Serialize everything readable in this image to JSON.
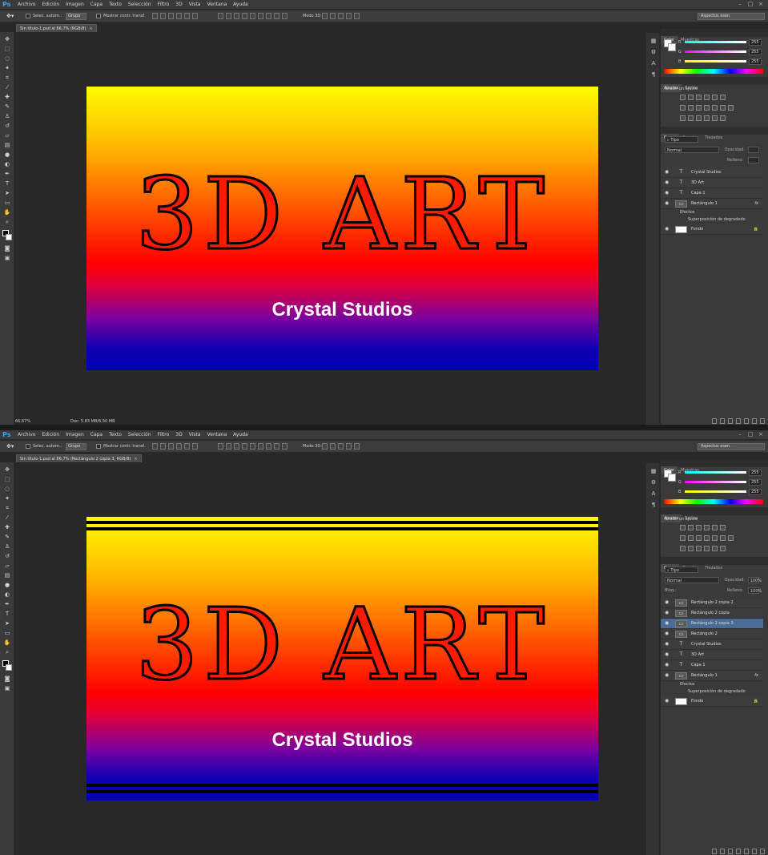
{
  "colors": {
    "workspace_bg": "#282828",
    "panel_bg": "#3a3a3a",
    "layer_selected": "#4a6c94",
    "headline_fill": "#ff1a00",
    "subtitle_text": "#ffffff"
  },
  "app": {
    "logo": "Ps",
    "menu": [
      "Archivo",
      "Edición",
      "Imagen",
      "Capa",
      "Texto",
      "Selección",
      "Filtro",
      "3D",
      "Vista",
      "Ventana",
      "Ayuda"
    ],
    "window_controls": [
      "–",
      "□",
      "×"
    ]
  },
  "options_bar": {
    "auto_select_label": "Selec. autom.:",
    "auto_select_value": "Grupo",
    "transform_label": "Mostrar contr. transf.",
    "mode_3d_label": "Modo 3D:",
    "workspace": "Aspectos esen."
  },
  "screens": [
    {
      "doc_tab": "Sin título-1.psd al 66,7% (RGB/8)",
      "zoom": "66,67%",
      "doc_size": "Doc: 5,83 MB/6,50 MB",
      "artwork": {
        "headline": "3D ART",
        "subtitle": "Crystal Studios",
        "stripes": false
      },
      "color_panel": {
        "tabs": [
          "Color",
          "Muestras"
        ],
        "r": "255",
        "g": "255",
        "b": "255",
        "r_label": "R",
        "g_label": "G",
        "b_label": "B"
      },
      "adjust_panel": {
        "tabs": [
          "Ajustes",
          "Estilos"
        ],
        "title": "Añadir un ajuste"
      },
      "layers_panel": {
        "tabs": [
          "Capas",
          "Canales",
          "Trazados"
        ],
        "filter": "Tipo",
        "blend": "Normal",
        "opacity_label": "Opacidad:",
        "opacity": "",
        "fill_label": "Relleno:",
        "fill": "",
        "lock_label": "",
        "layers": [
          {
            "name": "Crystal Studios",
            "kind": "text",
            "selected": false
          },
          {
            "name": "3D Art",
            "kind": "text",
            "selected": false
          },
          {
            "name": "Capa 1",
            "kind": "text",
            "selected": false
          },
          {
            "name": "Rectángulo 1",
            "kind": "shape",
            "selected": false,
            "fx": "fx",
            "effects": "Efectos",
            "effect": "Superposición de degradado"
          },
          {
            "name": "Fondo",
            "kind": "bg",
            "selected": false,
            "lock": "🔒"
          }
        ]
      }
    },
    {
      "doc_tab": "Sin título-1.psd al 66,7% (Rectángulo 2 copia 3, RGB/8)",
      "zoom": "",
      "doc_size": "",
      "artwork": {
        "headline": "3D ART",
        "subtitle": "Crystal Studios",
        "stripes": true
      },
      "color_panel": {
        "tabs": [
          "Color",
          "Muestras"
        ],
        "r": "255",
        "g": "255",
        "b": "255",
        "r_label": "R",
        "g_label": "G",
        "b_label": "B"
      },
      "adjust_panel": {
        "tabs": [
          "Ajustes",
          "Estilos"
        ],
        "title": "Añadir un ajuste"
      },
      "layers_panel": {
        "tabs": [
          "Capas",
          "Canales",
          "Trazados"
        ],
        "filter": "Tipo",
        "blend": "Normal",
        "opacity_label": "Opacidad:",
        "opacity": "100%",
        "fill_label": "Relleno:",
        "fill": "100%",
        "lock_label": "Bloq.:",
        "layers": [
          {
            "name": "Rectángulo 2 copia 2",
            "kind": "shape",
            "selected": false
          },
          {
            "name": "Rectángulo 2 copia",
            "kind": "shape",
            "selected": false
          },
          {
            "name": "Rectángulo 2 copia 3",
            "kind": "shape",
            "selected": true
          },
          {
            "name": "Rectángulo 2",
            "kind": "shape",
            "selected": false
          },
          {
            "name": "Crystal Studios",
            "kind": "text",
            "selected": false
          },
          {
            "name": "3D Art",
            "kind": "text",
            "selected": false
          },
          {
            "name": "Capa 1",
            "kind": "text",
            "selected": false
          },
          {
            "name": "Rectángulo 1",
            "kind": "shape",
            "selected": false,
            "fx": "fx",
            "effects": "Efectos",
            "effect": "Superposición de degradado"
          },
          {
            "name": "Fondo",
            "kind": "bg",
            "selected": false,
            "lock": "🔒"
          }
        ]
      }
    }
  ]
}
